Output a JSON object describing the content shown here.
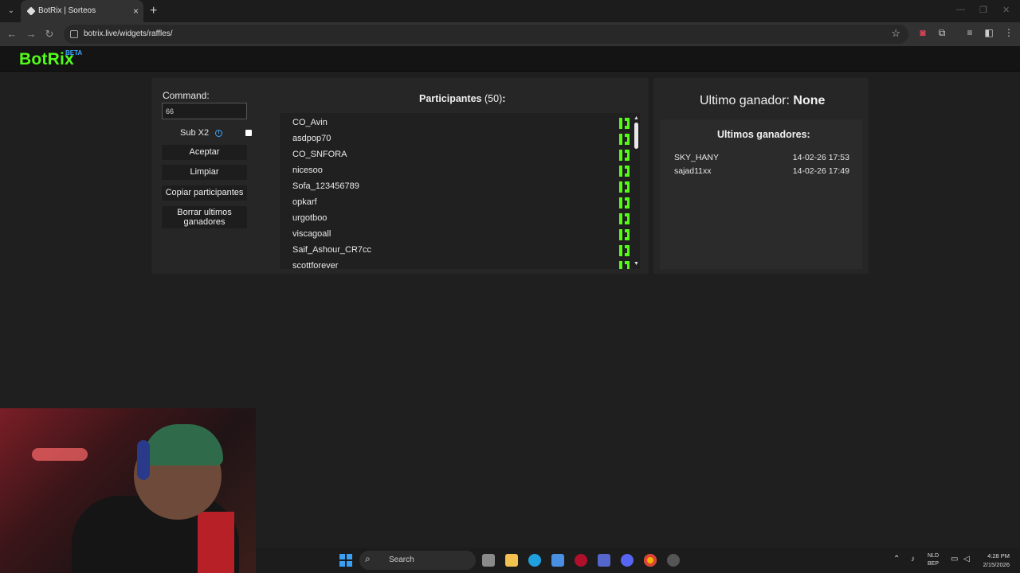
{
  "browser": {
    "tab_title": "BotRix | Sorteos",
    "url": "botrix.live/widgets/raffles/",
    "new_tab_label": "+",
    "close_tab_label": "×"
  },
  "site": {
    "logo_text": "BotRix",
    "logo_badge": "BETA",
    "brand_color": "#53fc18"
  },
  "controls": {
    "command_label": "Command:",
    "command_value": "66",
    "sub_label": "Sub X2",
    "sub_checked": false,
    "accept_label": "Aceptar",
    "clear_label": "Limpiar",
    "copy_label": "Copiar participantes",
    "delete_winners_label": "Borrar ultimos ganadores"
  },
  "participants": {
    "title": "Participantes",
    "count": "(50)",
    "suffix": ":",
    "items": [
      "CO_Avin",
      "asdpop70",
      "CO_SNFORA",
      "nicesoo",
      "Sofa_123456789",
      "opkarf",
      "urgotboo",
      "viscagoall",
      "Saif_Ashour_CR7cc",
      "scottforever"
    ]
  },
  "winner": {
    "label": "Ultimo ganador:",
    "name": "None",
    "history_title": "Ultimos ganadores:",
    "history": [
      {
        "user": "SKY_HANY",
        "date": "14-02-26 17:53"
      },
      {
        "user": "sajad11xx",
        "date": "14-02-26 17:49"
      }
    ]
  },
  "taskbar": {
    "search_label": "Search",
    "lang_top": "NLD",
    "lang_bottom": "BEP",
    "time": "4:28 PM",
    "date": "2/15/2026"
  }
}
